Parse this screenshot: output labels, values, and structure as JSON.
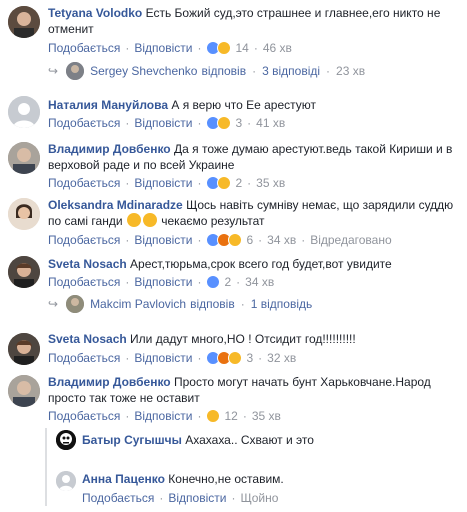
{
  "labels": {
    "like": "Подобається",
    "reply": "Відповісти",
    "dot": "·"
  },
  "comments": [
    {
      "author": "Tetyana Volodko",
      "text": "Есть Божий суд,это страшнее и главнее,его никто не отменит",
      "reactions_count": "14",
      "time": "46 хв",
      "replies": {
        "name": "Sergey Shevchenko",
        "verb": "відповів",
        "count": "3 відповіді",
        "time": "23 хв"
      }
    },
    {
      "author": "Наталия Мануйлова",
      "text": "А я верю что Ее арестуют",
      "reactions_count": "3",
      "time": "41 хв"
    },
    {
      "author": "Владимир Довбенко",
      "text": "Да я тоже думаю арестуют.ведь такой Кириши и в верховой раде и по всей Украине",
      "reactions_count": "2",
      "time": "35 хв"
    },
    {
      "author": "Oleksandra Mdinaradze",
      "text_before": "Щось навіть сумніву немає, що зарядили суддю по самі ганди",
      "text_after": "чекаємо результат",
      "reactions_count": "6",
      "time": "34 хв",
      "edited": "Відредаговано"
    },
    {
      "author": "Sveta Nosach",
      "text": "Арест,тюрьма,срок всего год будет,вот увидите",
      "reactions_count": "2",
      "time": "34 хв",
      "replies": {
        "name": "Makcim Pavlovich",
        "verb": "відповів",
        "count": "1 відповідь"
      }
    },
    {
      "author": "Sveta Nosach",
      "text": "Или дадут много,НО ! Отсидит год!!!!!!!!!!",
      "reactions_count": "3",
      "time": "32 хв"
    },
    {
      "author": "Владимир Довбенко",
      "text": "Просто могут начать бунт Харьковчане.Народ просто так тоже не оставит",
      "reactions_count": "12",
      "time": "35 хв",
      "nested": [
        {
          "author": "Батыр Сугышчы",
          "text": "Ахахаха.. Схвают и это"
        },
        {
          "author": "Анна Паценко",
          "text": "Конечно,не оставим.",
          "status": "Щойно"
        }
      ]
    }
  ],
  "colors": {
    "author": "#365899",
    "action_link": "#4b67a1",
    "meta": "#90949c",
    "like": "#5890ff",
    "haha": "#f7b928",
    "angry": "#e9710f"
  }
}
